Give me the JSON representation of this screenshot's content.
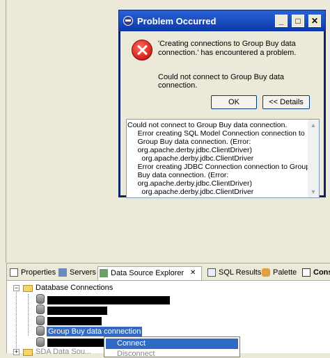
{
  "dialog": {
    "title": "Problem Occurred",
    "message": "'Creating connections to Group Buy data connection.' has encountered a problem.",
    "submessage": "Could not connect to Group Buy data connection.",
    "ok_label": "OK",
    "details_label": "<< Details",
    "details_text": "Could not connect to Group Buy data connection.\n     Error creating SQL Model Connection connection to\n     Group Buy data connection. (Error:\n     org.apache.derby.jdbc.ClientDriver)\n       org.apache.derby.jdbc.ClientDriver\n     Error creating JDBC Connection connection to Group\n     Buy data connection. (Error:\n     org.apache.derby.jdbc.ClientDriver)\n       org.apache.derby.jdbc.ClientDriver"
  },
  "tabs": [
    {
      "label": "Properties",
      "icon": "properties-icon"
    },
    {
      "label": "Servers",
      "icon": "servers-icon"
    },
    {
      "label": "Data Source Explorer",
      "icon": "data-source-icon",
      "close": "✕"
    },
    {
      "label": "SQL Results",
      "icon": "sql-results-icon"
    },
    {
      "label": "Palette",
      "icon": "palette-icon"
    },
    {
      "label": "Cons",
      "icon": "console-icon"
    }
  ],
  "tree": {
    "root_label": "Database Connections",
    "selected_label": "Group Buy data connection",
    "partial_label": "SDA Data Sou..."
  },
  "context_menu": {
    "items": [
      "Connect",
      "Disconnect"
    ]
  }
}
